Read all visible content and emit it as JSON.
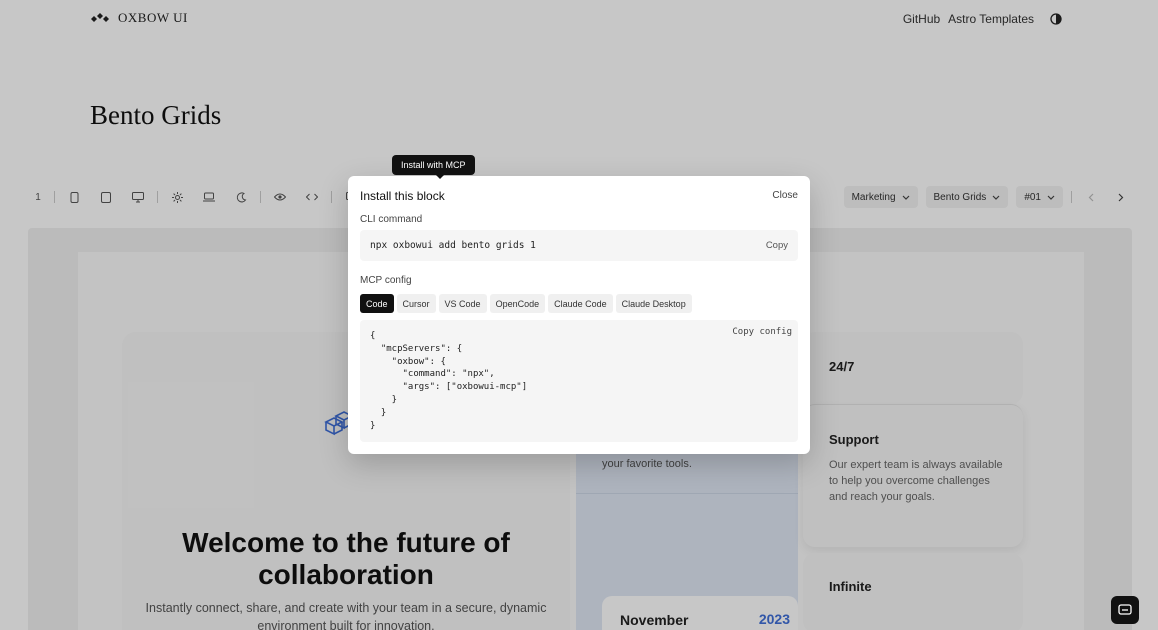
{
  "nav": {
    "brand": "OXBOW UI",
    "links": [
      "GitHub",
      "Astro Templates"
    ]
  },
  "page": {
    "title": "Bento Grids"
  },
  "toolbar": {
    "index": "1",
    "selects": [
      "Marketing",
      "Bento Grids",
      "#01"
    ]
  },
  "tooltip": {
    "text": "Install with MCP"
  },
  "modal": {
    "title": "Install this block",
    "close_label": "Close",
    "cli_label": "CLI command",
    "cli_command": "npx oxbowui add bento grids 1",
    "cli_copy_label": "Copy",
    "mcp_label": "MCP config",
    "tabs": [
      "Code",
      "Cursor",
      "VS Code",
      "OpenCode",
      "Claude Code",
      "Claude Desktop"
    ],
    "active_tab": "Code",
    "code": "{\n  \"mcpServers\": {\n    \"oxbow\": {\n      \"command\": \"npx\",\n      \"args\": [\"oxbowui-mcp\"]\n    }\n  }\n}",
    "copy_config_label": "Copy config"
  },
  "bento": {
    "headline": "Welcome to the future of collaboration",
    "subtext": "Instantly connect, share, and create with your team in a secure, dynamic environment built for innovation.",
    "middle_text": "your favorite tools.",
    "calendar_month": "November",
    "calendar_year": "2023",
    "stats": [
      {
        "title": "24/7"
      },
      {
        "title": "Support",
        "description": "Our expert team is always available to help you overcome challenges and reach your goals."
      },
      {
        "title": "Infinite"
      }
    ]
  },
  "colors": {
    "accent_blue": "#3f6fd8",
    "dark": "#111111",
    "overlay": "rgba(0,0,0,0.22)"
  }
}
